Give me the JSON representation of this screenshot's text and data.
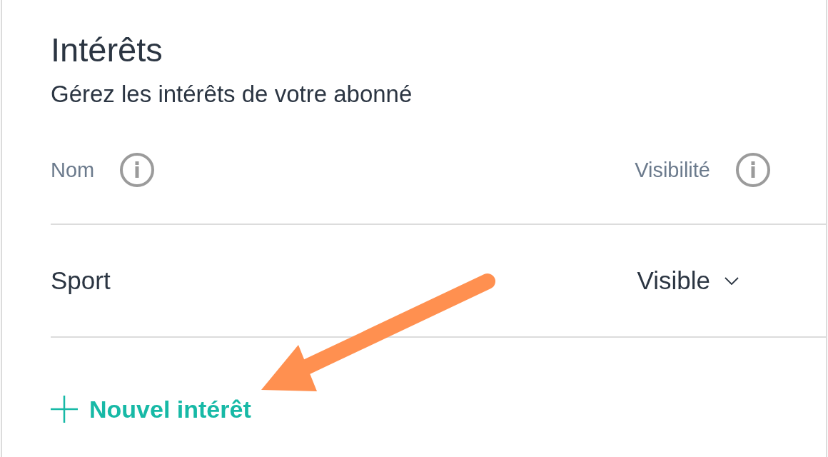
{
  "section": {
    "title": "Intérêts",
    "subtitle": "Gérez les intérêts de votre abonné"
  },
  "table": {
    "columns": [
      {
        "label": "Nom"
      },
      {
        "label": "Visibilité"
      }
    ],
    "rows": [
      {
        "name": "Sport",
        "visibility": "Visible"
      }
    ]
  },
  "add_button": {
    "label": "Nouvel intérêt"
  }
}
